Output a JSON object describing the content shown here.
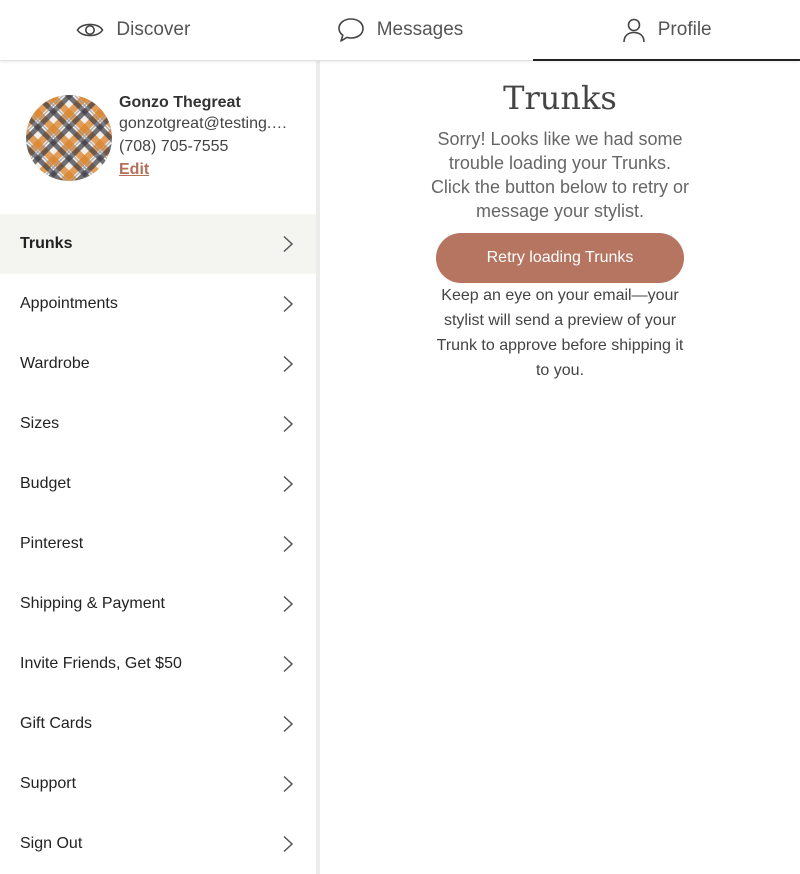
{
  "tabs": [
    {
      "label": "Discover",
      "icon": "eye-icon"
    },
    {
      "label": "Messages",
      "icon": "chat-bubble-icon"
    },
    {
      "label": "Profile",
      "icon": "person-icon"
    }
  ],
  "profile": {
    "name": "Gonzo Thegreat",
    "email": "gonzotgreat@testing.com",
    "phone": "(708) 705-7555",
    "edit_label": "Edit"
  },
  "menu": [
    {
      "label": "Trunks",
      "selected": true
    },
    {
      "label": "Appointments"
    },
    {
      "label": "Wardrobe"
    },
    {
      "label": "Sizes"
    },
    {
      "label": "Budget"
    },
    {
      "label": "Pinterest"
    },
    {
      "label": "Shipping & Payment"
    },
    {
      "label": "Invite Friends, Get $50"
    },
    {
      "label": "Gift Cards"
    },
    {
      "label": "Support"
    },
    {
      "label": "Sign Out"
    }
  ],
  "main": {
    "title": "Trunks",
    "error_message": "Sorry! Looks like we had some trouble loading your Trunks. Click the button below to retry or message your stylist.",
    "retry_label": "Retry loading Trunks",
    "note": "Keep an eye on your email—your stylist will send a preview of your Trunk to approve before shipping it to you."
  },
  "colors": {
    "accent": "#b57560",
    "link": "#b57058",
    "selected_bg": "#f4f4f1"
  }
}
